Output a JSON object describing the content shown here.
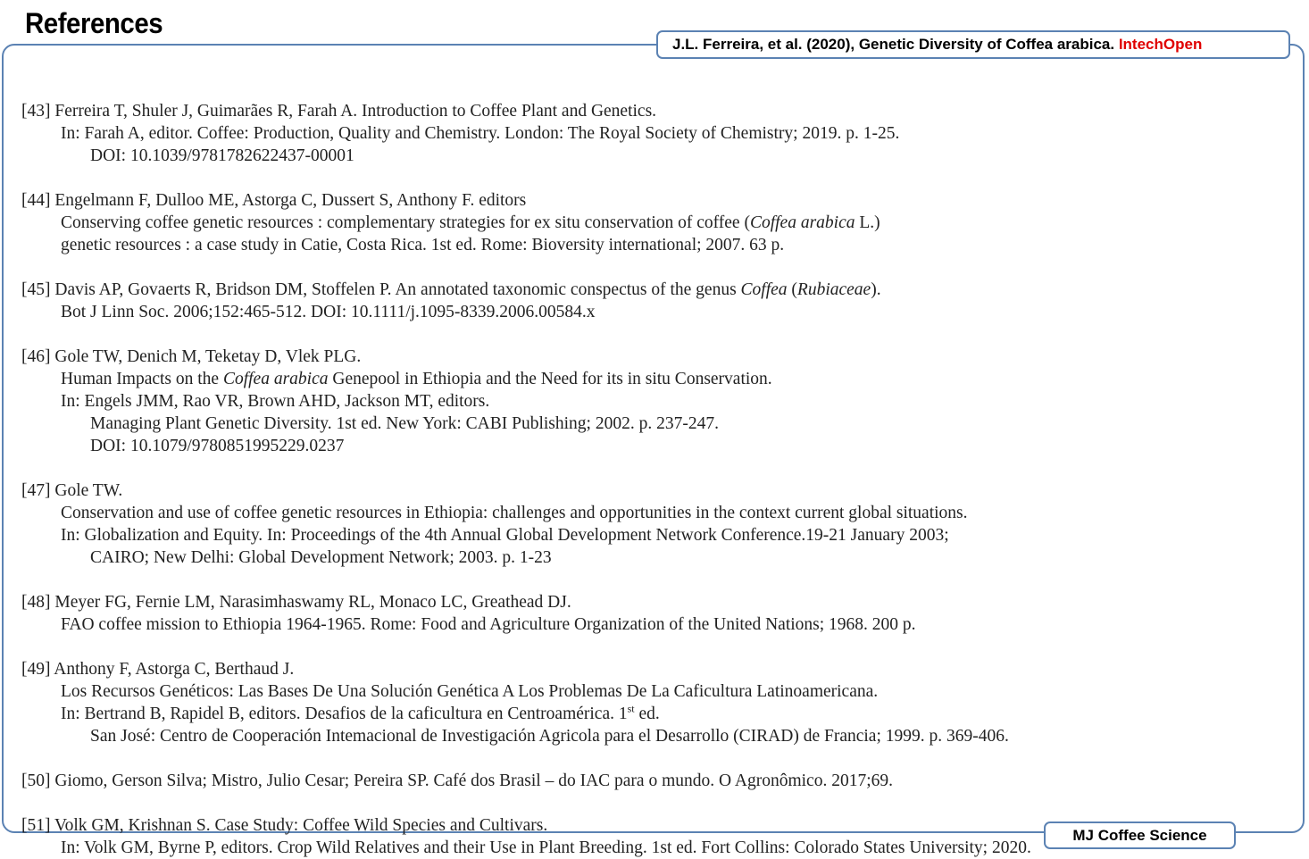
{
  "page": {
    "title": "References",
    "citation": {
      "prefix": "J.L. Ferreira,  et al. (2020), Genetic Diversity of Coffea arabica. ",
      "publisher": "IntechOpen"
    },
    "footer_badge": "MJ Coffee Science"
  },
  "colors": {
    "frame": "#5b82b3",
    "publisher": "#e00000"
  },
  "references": [
    {
      "number": "[43]",
      "lines": [
        {
          "level": 1,
          "segments": [
            {
              "text": "[43] Ferreira T, Shuler J, Guimarães R, Farah A. Introduction to Coffee Plant and Genetics."
            }
          ]
        },
        {
          "level": 2,
          "segments": [
            {
              "text": "In: Farah A, editor. Coffee: Production, Quality and Chemistry. London: The Royal Society of Chemistry; 2019. p. 1-25."
            }
          ]
        },
        {
          "level": 3,
          "segments": [
            {
              "text": "DOI: 10.1039/9781782622437-00001"
            }
          ]
        }
      ]
    },
    {
      "number": "[44]",
      "lines": [
        {
          "level": 1,
          "segments": [
            {
              "text": "[44] Engelmann F, Dulloo ME, Astorga C, Dussert S, Anthony F. editors"
            }
          ]
        },
        {
          "level": 2,
          "segments": [
            {
              "text": "Conserving coffee genetic resources : complementary strategies for ex situ conservation of coffee ("
            },
            {
              "text": "Coffea arabica",
              "italic": true
            },
            {
              "text": " L.)"
            }
          ]
        },
        {
          "level": 2,
          "segments": [
            {
              "text": "genetic resources : a case study in Catie, Costa Rica. 1st ed. Rome: Bioversity international; 2007. 63 p."
            }
          ]
        }
      ]
    },
    {
      "number": "[45]",
      "lines": [
        {
          "level": 1,
          "segments": [
            {
              "text": "[45] Davis AP, Govaerts R, Bridson DM, Stoffelen P. An annotated taxonomic conspectus of the genus "
            },
            {
              "text": "Coffea",
              "italic": true
            },
            {
              "text": " ("
            },
            {
              "text": "Rubiaceae",
              "italic": true
            },
            {
              "text": ")."
            }
          ]
        },
        {
          "level": 2,
          "segments": [
            {
              "text": "Bot J Linn Soc. 2006;152:465-512.  DOI: 10.1111/j.1095-8339.2006.00584.x"
            }
          ]
        }
      ]
    },
    {
      "number": "[46]",
      "lines": [
        {
          "level": 1,
          "segments": [
            {
              "text": "[46] Gole TW, Denich M, Teketay D, Vlek PLG."
            }
          ]
        },
        {
          "level": 2,
          "segments": [
            {
              "text": "Human Impacts on the "
            },
            {
              "text": "Coffea arabica",
              "italic": true
            },
            {
              "text": " Genepool in Ethiopia and the Need for its in situ Conservation."
            }
          ]
        },
        {
          "level": 2,
          "segments": [
            {
              "text": "In: Engels JMM, Rao VR, Brown AHD, Jackson MT, editors."
            }
          ]
        },
        {
          "level": 3,
          "segments": [
            {
              "text": "Managing Plant Genetic Diversity. 1st ed. New York: CABI Publishing; 2002. p. 237-247."
            }
          ]
        },
        {
          "level": 3,
          "segments": [
            {
              "text": "DOI: 10.1079/9780851995229.0237"
            }
          ]
        }
      ]
    },
    {
      "number": "[47]",
      "lines": [
        {
          "level": 1,
          "segments": [
            {
              "text": "[47] Gole TW."
            }
          ]
        },
        {
          "level": 2,
          "segments": [
            {
              "text": "Conservation and use of coffee genetic resources in Ethiopia: challenges and opportunities in the context current global situations."
            }
          ]
        },
        {
          "level": 2,
          "segments": [
            {
              "text": "In: Globalization and Equity. In: Proceedings of the 4th Annual Global Development Network Conference.19-21 January 2003;"
            }
          ]
        },
        {
          "level": 3,
          "segments": [
            {
              "text": "CAIRO; New Delhi: Global Development Network; 2003. p. 1-23"
            }
          ]
        }
      ]
    },
    {
      "number": "[48]",
      "lines": [
        {
          "level": 1,
          "segments": [
            {
              "text": "[48] Meyer FG, Fernie LM, Narasimhaswamy RL, Monaco LC, Greathead DJ."
            }
          ]
        },
        {
          "level": 2,
          "segments": [
            {
              "text": "FAO coffee mission to Ethiopia 1964-1965. Rome: Food and Agriculture Organization of the United Nations; 1968. 200 p."
            }
          ]
        }
      ]
    },
    {
      "number": "[49]",
      "lines": [
        {
          "level": 1,
          "segments": [
            {
              "text": "[49] Anthony F, Astorga C, Berthaud J."
            }
          ]
        },
        {
          "level": 2,
          "segments": [
            {
              "text": "Los Recursos Genéticos: Las Bases De Una Solución Genética A Los Problemas De La Caficultura Latinoamericana."
            }
          ]
        },
        {
          "level": 2,
          "segments": [
            {
              "text": "In: Bertrand B, Rapidel B, editors. Desafios de la caficultura en Centroamérica. 1"
            },
            {
              "text": "st",
              "sup": true
            },
            {
              "text": " ed."
            }
          ]
        },
        {
          "level": 3,
          "segments": [
            {
              "text": "San José: Centro de Cooperación Intemacional de Investigación Agricola para el Desarrollo (CIRAD) de Francia; 1999. p. 369-406."
            }
          ]
        }
      ]
    },
    {
      "number": "[50]",
      "lines": [
        {
          "level": 1,
          "segments": [
            {
              "text": "[50] Giomo, Gerson Silva; Mistro, Julio Cesar; Pereira SP. Café dos Brasil – do IAC para o mundo. O Agronômico. 2017;69."
            }
          ]
        }
      ]
    },
    {
      "number": "[51]",
      "lines": [
        {
          "level": 1,
          "segments": [
            {
              "text": "[51] Volk GM, Krishnan S. Case Study: Coffee Wild Species and Cultivars."
            }
          ]
        },
        {
          "level": 2,
          "segments": [
            {
              "text": "In: Volk GM, Byrne P, editors. Crop Wild Relatives and their Use in Plant Breeding. 1st ed. Fort Collins: Colorado States University; 2020."
            }
          ]
        }
      ]
    }
  ]
}
